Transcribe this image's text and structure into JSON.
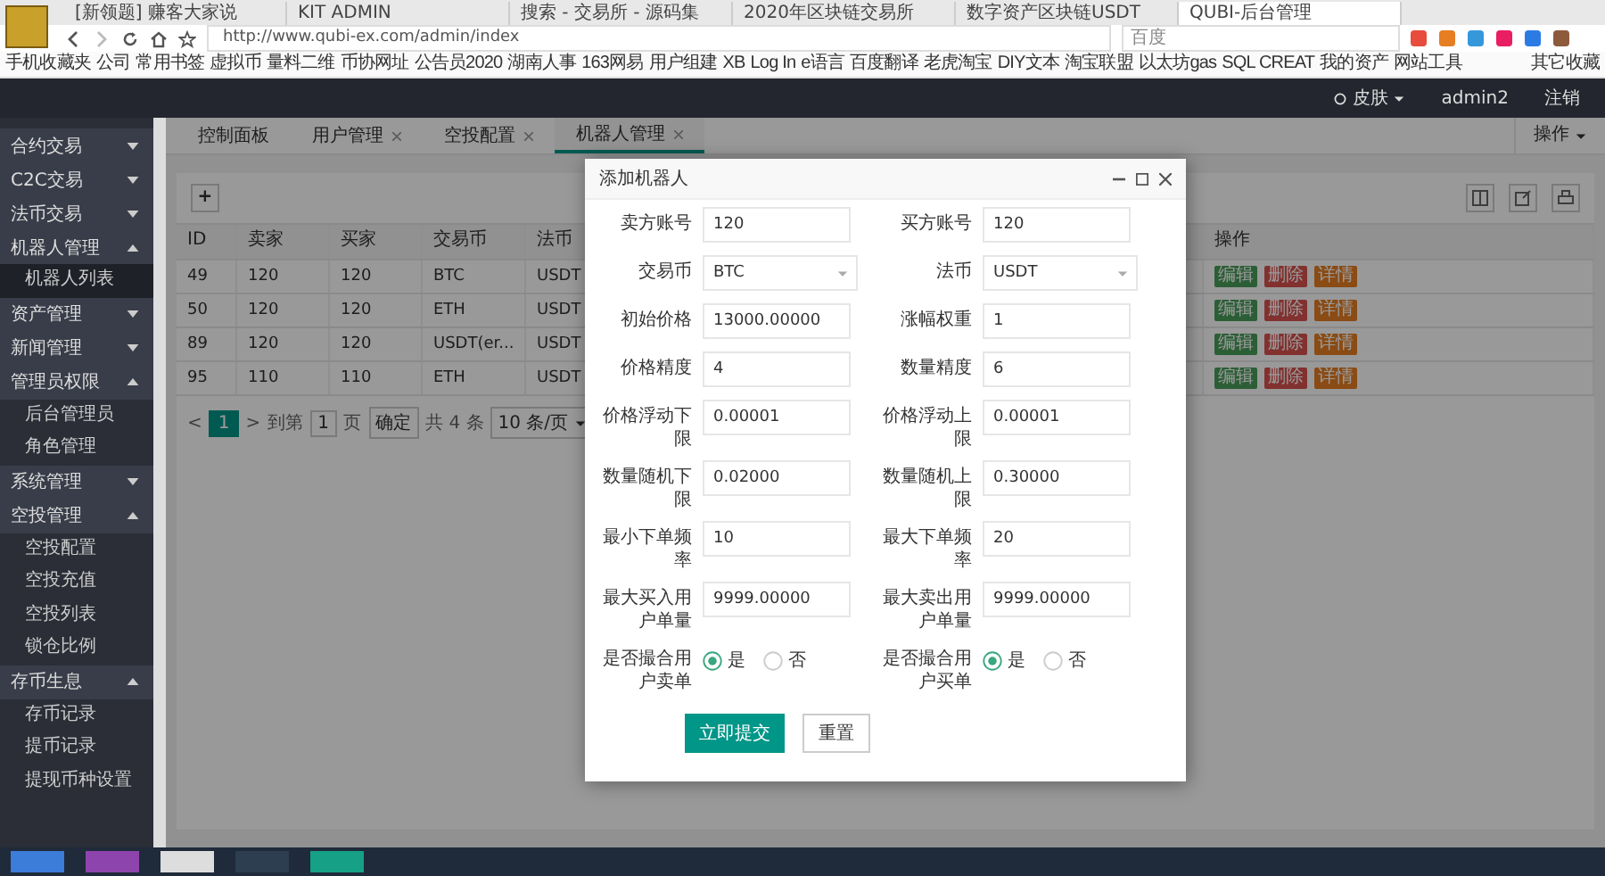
{
  "browser": {
    "tabs": [
      {
        "title": "[新领题] 赚客大家说",
        "selected": false
      },
      {
        "title": "KIT ADMIN",
        "selected": false
      },
      {
        "title": "搜索 - 交易所 - 源码集",
        "selected": false
      },
      {
        "title": "2020年区块链交易所",
        "selected": false
      },
      {
        "title": "数字资产区块链USDT",
        "selected": false
      },
      {
        "title": "QUBI-后台管理",
        "selected": true
      }
    ],
    "address": "http://www.qubi-ex.com/admin/index",
    "search_placeholder": "百度",
    "bookmarks": [
      "手机收藏夹",
      "公司",
      "常用书签",
      "虚拟币",
      "量料二维",
      "币协网址",
      "公告员2020",
      "湖南人事",
      "163网易",
      "用户组建",
      "XB",
      "Log In",
      "e语言",
      "百度翻译",
      "老虎淘宝",
      "DIY文本",
      "淘宝联盟",
      "以太坊gas",
      "SQL CREAT",
      "我的资产",
      "网站工具"
    ],
    "other_bookmarks": "其它收藏"
  },
  "header": {
    "skin": "皮肤",
    "user": "admin2",
    "logout": "注销"
  },
  "sidebar": {
    "items": [
      {
        "label": "合约交易",
        "expanded": false
      },
      {
        "label": "C2C交易",
        "expanded": false
      },
      {
        "label": "法币交易",
        "expanded": false
      },
      {
        "label": "机器人管理",
        "expanded": true,
        "children": [
          {
            "label": "机器人列表",
            "selected": true
          }
        ]
      },
      {
        "label": "资产管理",
        "expanded": false
      },
      {
        "label": "新闻管理",
        "expanded": false
      },
      {
        "label": "管理员权限",
        "expanded": true,
        "children": [
          {
            "label": "后台管理员",
            "selected": false
          },
          {
            "label": "角色管理",
            "selected": false
          }
        ]
      },
      {
        "label": "系统管理",
        "expanded": false
      },
      {
        "label": "空投管理",
        "expanded": true,
        "children": [
          {
            "label": "空投配置",
            "selected": false
          },
          {
            "label": "空投充值",
            "selected": false
          },
          {
            "label": "空投列表",
            "selected": false
          },
          {
            "label": "锁仓比例",
            "selected": false
          }
        ]
      },
      {
        "label": "存币生息",
        "expanded": true,
        "children": [
          {
            "label": "存币记录",
            "selected": false
          },
          {
            "label": "提币记录",
            "selected": false
          },
          {
            "label": "提现币种设置",
            "selected": false
          }
        ]
      }
    ]
  },
  "page_tabs": [
    {
      "label": "控制面板",
      "closable": false,
      "selected": false
    },
    {
      "label": "用户管理",
      "closable": true,
      "selected": false
    },
    {
      "label": "空投配置",
      "closable": true,
      "selected": false
    },
    {
      "label": "机器人管理",
      "closable": true,
      "selected": true
    }
  ],
  "operations_button": "操作",
  "add_button": "+",
  "table": {
    "columns": [
      "ID",
      "卖家",
      "买家",
      "交易币",
      "法币",
      "操作"
    ],
    "rows": [
      {
        "cells": [
          "49",
          "120",
          "120",
          "BTC",
          "USDT"
        ],
        "actions": [
          {
            "label": "编辑",
            "kind": "edit"
          },
          {
            "label": "删除",
            "kind": "delete"
          },
          {
            "label": "详情",
            "kind": "detail"
          }
        ]
      },
      {
        "cells": [
          "50",
          "120",
          "120",
          "ETH",
          "USDT"
        ],
        "actions": [
          {
            "label": "编辑",
            "kind": "edit"
          },
          {
            "label": "删除",
            "kind": "delete"
          },
          {
            "label": "详情",
            "kind": "detail"
          }
        ]
      },
      {
        "cells": [
          "89",
          "120",
          "120",
          "USDT(er...",
          "USDT"
        ],
        "actions": [
          {
            "label": "编辑",
            "kind": "edit"
          },
          {
            "label": "删除",
            "kind": "delete"
          },
          {
            "label": "详情",
            "kind": "detail"
          }
        ]
      },
      {
        "cells": [
          "95",
          "110",
          "110",
          "ETH",
          "USDT"
        ],
        "actions": [
          {
            "label": "编辑",
            "kind": "edit"
          },
          {
            "label": "删除",
            "kind": "delete"
          },
          {
            "label": "详情",
            "kind": "detail"
          }
        ]
      }
    ]
  },
  "pagination": {
    "prev": "<",
    "pages": [
      {
        "label": "1",
        "selected": true
      }
    ],
    "next": ">",
    "goto_label": "到第",
    "goto_value": "1",
    "page_unit": "页",
    "confirm": "确定",
    "total": "共 4 条",
    "page_size": "10 条/页"
  },
  "dialog": {
    "title": "添加机器人",
    "rows": [
      {
        "fields": [
          {
            "label": "卖方账号",
            "kind": "input",
            "value": "120"
          },
          {
            "label": "买方账号",
            "kind": "input",
            "value": "120"
          }
        ]
      },
      {
        "fields": [
          {
            "label": "交易币",
            "kind": "select",
            "value": "BTC"
          },
          {
            "label": "法币",
            "kind": "select",
            "value": "USDT"
          }
        ]
      },
      {
        "fields": [
          {
            "label": "初始价格",
            "kind": "input",
            "value": "13000.00000"
          },
          {
            "label": "涨幅权重",
            "kind": "input",
            "value": "1"
          }
        ]
      },
      {
        "fields": [
          {
            "label": "价格精度",
            "kind": "input",
            "value": "4"
          },
          {
            "label": "数量精度",
            "kind": "input",
            "value": "6"
          }
        ]
      },
      {
        "fields": [
          {
            "label": "价格浮动下限",
            "kind": "input",
            "value": "0.00001"
          },
          {
            "label": "价格浮动上限",
            "kind": "input",
            "value": "0.00001"
          }
        ]
      },
      {
        "fields": [
          {
            "label": "数量随机下限",
            "kind": "input",
            "value": "0.02000"
          },
          {
            "label": "数量随机上限",
            "kind": "input",
            "value": "0.30000"
          }
        ]
      },
      {
        "fields": [
          {
            "label": "最小下单频率",
            "kind": "input",
            "value": "10"
          },
          {
            "label": "最大下单频率",
            "kind": "input",
            "value": "20"
          }
        ]
      },
      {
        "fields": [
          {
            "label": "最大买入用户单量",
            "kind": "input",
            "value": "9999.00000"
          },
          {
            "label": "最大卖出用户单量",
            "kind": "input",
            "value": "9999.00000"
          }
        ]
      },
      {
        "fields": [
          {
            "label": "是否撮合用户卖单",
            "kind": "radio",
            "options": [
              {
                "label": "是",
                "selected": true
              },
              {
                "label": "否",
                "selected": false
              }
            ]
          },
          {
            "label": "是否撮合用户买单",
            "kind": "radio",
            "options": [
              {
                "label": "是",
                "selected": true
              },
              {
                "label": "否",
                "selected": false
              }
            ]
          }
        ]
      }
    ],
    "submit": "立即提交",
    "reset": "重置"
  }
}
